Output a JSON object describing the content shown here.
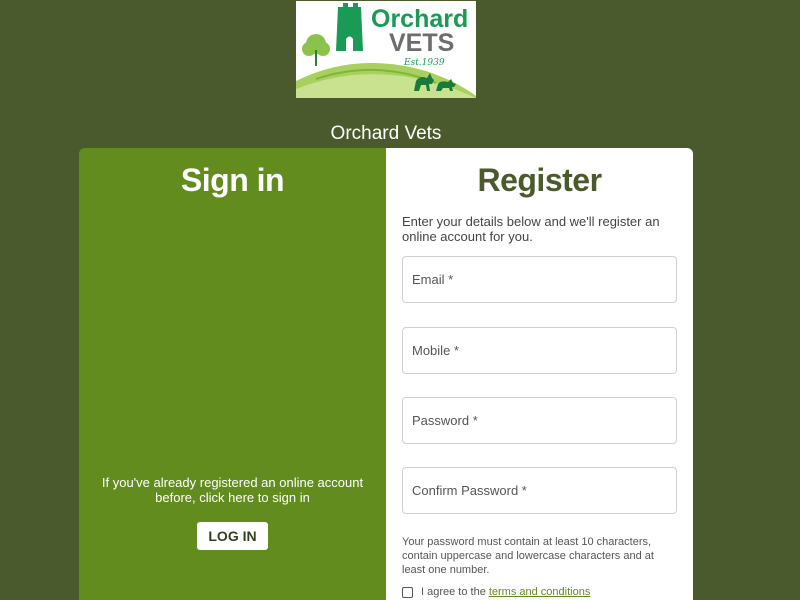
{
  "logo": {
    "line1": "Orchard",
    "line2": "VETS",
    "est": "Est.1939"
  },
  "site_name": "Orchard Vets",
  "signin": {
    "title": "Sign in",
    "description": "If you've already registered an online account before, click here to sign in",
    "button_label": "LOG IN"
  },
  "register": {
    "title": "Register",
    "intro": "Enter your details below and we'll register an online account for you.",
    "email_placeholder": "Email *",
    "mobile_placeholder": "Mobile *",
    "password_placeholder": "Password *",
    "confirm_password_placeholder": "Confirm Password *",
    "password_note": "Your password must contain at least 10 characters, contain uppercase and lowercase characters and at least one number.",
    "agree_text": "I agree to the",
    "terms_link": "terms and conditions"
  },
  "colors": {
    "background": "#4b5a2d",
    "signin_panel": "#628c1d",
    "logo_green": "#1a9a55",
    "logo_grey": "#6d6d6d"
  }
}
